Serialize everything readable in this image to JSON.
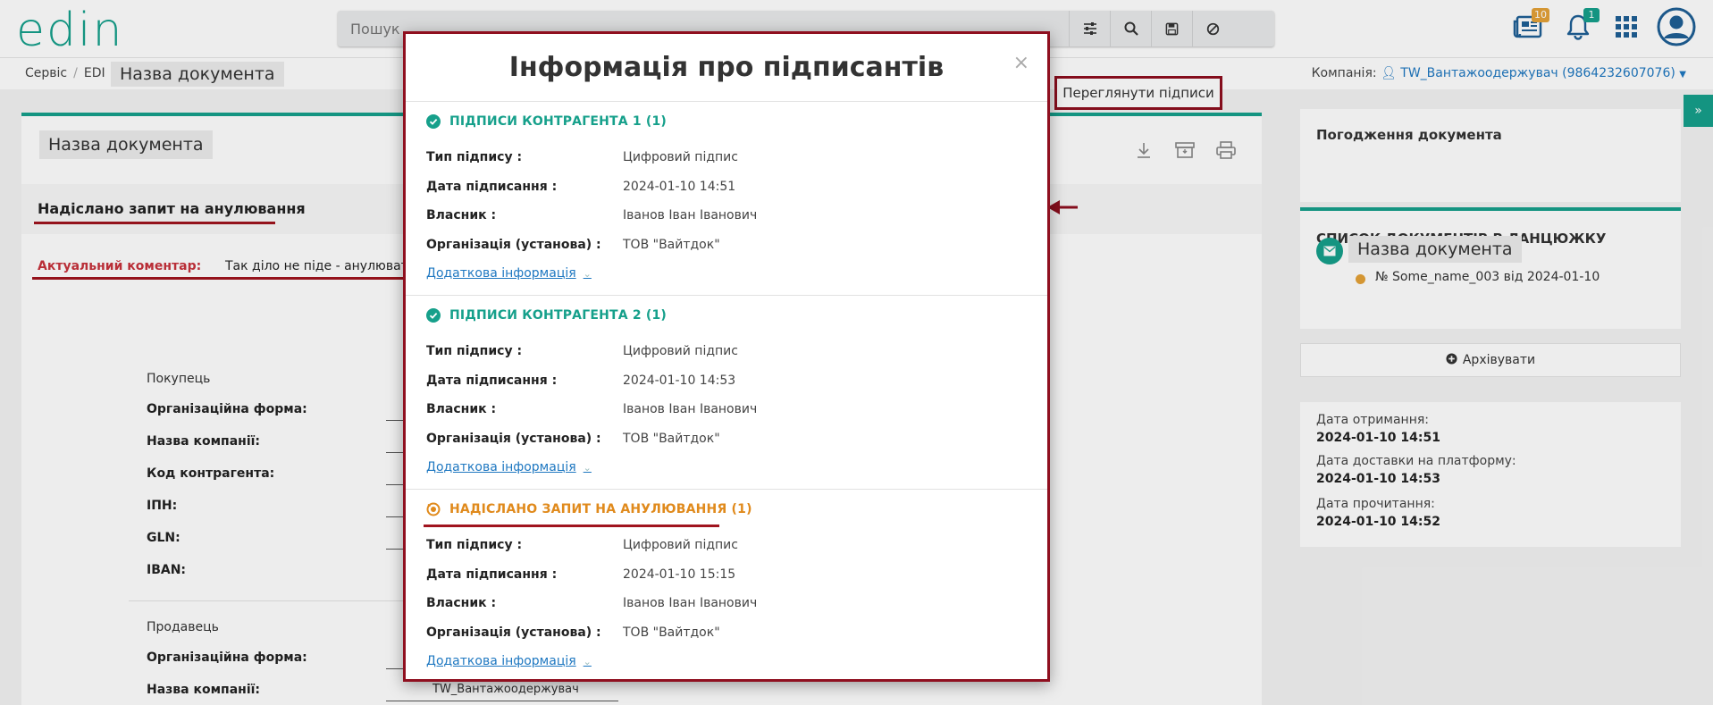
{
  "header": {
    "logo": "edin",
    "search_placeholder": "Пошук",
    "docs_badge": "10",
    "bell_badge": "1",
    "colors": {
      "accent": "#16a08b",
      "badge_docs": "#e5a237",
      "badge_bell": "#16a08b",
      "highlight": "#8f0f1f"
    }
  },
  "breadcrumb": {
    "item1": "Сервіс",
    "item2": "EDI",
    "title": "Назва документа"
  },
  "company": {
    "label": "Компанія:",
    "name": "TW_Вантажоодержувач (9864232607076)"
  },
  "document": {
    "title": "Назва документа",
    "status": "Надіслано запит на анулювання",
    "view_signatures": "Переглянути підписи",
    "comment_label": "Актуальний коментар:",
    "comment_text": "Так діло не піде - анулюватим",
    "buyer": {
      "section": "Покупець",
      "fields": [
        "Організаційна форма:",
        "Назва компанії:",
        "Код контрагента:",
        "ІПН:",
        "GLN:",
        "IBAN:"
      ]
    },
    "seller": {
      "section": "Продавець",
      "fields": [
        "Організаційна форма:",
        "Назва компанії:"
      ],
      "company_value": "TW_Вантажоодержувач"
    }
  },
  "sidebar": {
    "approval_title": "Погодження документа",
    "chain_title": "СПИСОК ДОКУМЕНТІВ В ЛАНЦЮЖКУ",
    "chain_doc": "Назва документа",
    "chain_no": "№ Some_name_003 від 2024-01-10",
    "archive": "Архівувати",
    "dates": [
      {
        "label": "Дата отримання:",
        "value": "2024-01-10 14:51"
      },
      {
        "label": "Дата доставки на платформу:",
        "value": "2024-01-10 14:53"
      },
      {
        "label": "Дата прочитання:",
        "value": "2024-01-10 14:52"
      }
    ]
  },
  "modal": {
    "title": "Інформація про підписантів",
    "close": "×",
    "keys": {
      "type": "Тип підпису :",
      "date": "Дата підписання :",
      "owner": "Власник :",
      "org": "Організація (установа) :"
    },
    "more": "Додаткова інформація",
    "blocks": [
      {
        "heading": "ПІДПИСИ КОНТРАГЕНТА 1 (1)",
        "type": "Цифровий підпис",
        "date": "2024-01-10 14:51",
        "owner": "Іванов Іван Іванович",
        "org": "ТОВ \"Вайтдок\""
      },
      {
        "heading": "ПІДПИСИ КОНТРАГЕНТА 2 (1)",
        "type": "Цифровий підпис",
        "date": "2024-01-10 14:53",
        "owner": "Іванов Іван Іванович",
        "org": "ТОВ \"Вайтдок\""
      },
      {
        "heading": "НАДІСЛАНО ЗАПИТ НА АНУЛЮВАННЯ (1)",
        "type": "Цифровий підпис",
        "date": "2024-01-10 15:15",
        "owner": "Іванов Іван Іванович",
        "org": "ТОВ \"Вайтдок\""
      }
    ]
  }
}
